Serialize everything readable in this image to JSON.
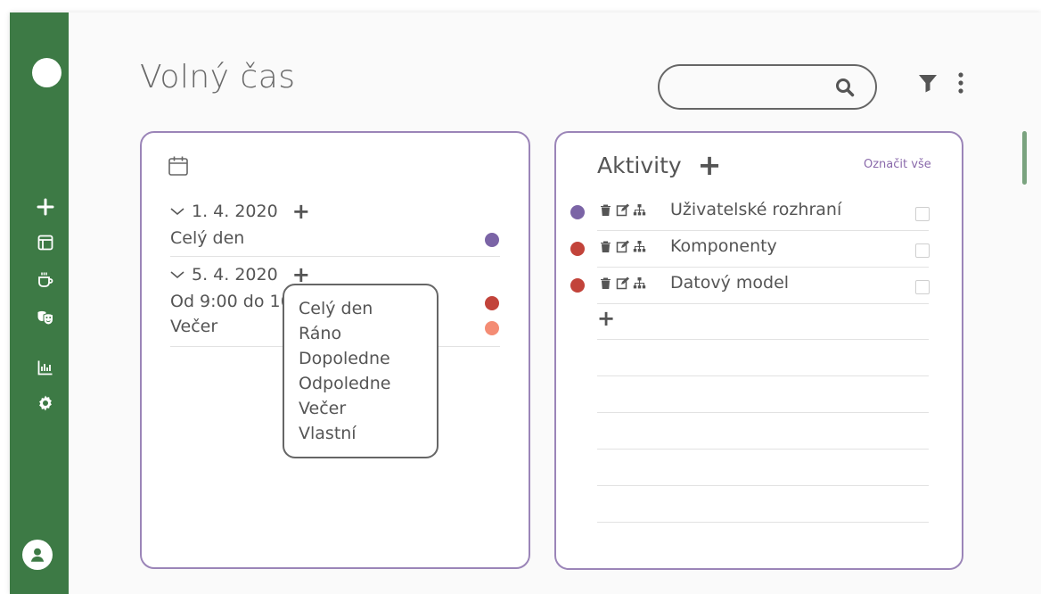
{
  "page": {
    "title": "Volný čas"
  },
  "search": {
    "value": "",
    "placeholder": ""
  },
  "toolbar": {
    "filter_icon": "filter-icon",
    "more_icon": "more-vertical-icon"
  },
  "sidebar": {
    "items": [
      {
        "icon": "plus-icon"
      },
      {
        "icon": "layout-icon"
      },
      {
        "icon": "coffee-icon"
      },
      {
        "icon": "theater-masks-icon"
      },
      {
        "icon": "bar-chart-icon"
      },
      {
        "icon": "gear-icon"
      }
    ],
    "avatar_icon": "user-icon"
  },
  "calendar": {
    "days": [
      {
        "date": "1. 4. 2020",
        "events": [
          {
            "label": "Celý den",
            "color": "#7b64a6"
          }
        ]
      },
      {
        "date": "5. 4. 2020",
        "events": [
          {
            "label": "Od 9:00 do 16:",
            "color": "#c2433a"
          },
          {
            "label": "Večer",
            "color": "#f48c74"
          }
        ]
      }
    ],
    "add_symbol": "+"
  },
  "dropdown": {
    "options": [
      "Celý den",
      "Ráno",
      "Dopoledne",
      "Odpoledne",
      "Večer",
      "Vlastní"
    ]
  },
  "activities": {
    "title": "Aktivity",
    "add_symbol": "+",
    "mark_all": "Označit vše",
    "items": [
      {
        "name": "Uživatelské rozhraní",
        "color": "#7b64a6",
        "checked": false
      },
      {
        "name": "Komponenty",
        "color": "#c2433a",
        "checked": false
      },
      {
        "name": "Datový model",
        "color": "#c2433a",
        "checked": false
      }
    ],
    "add_row_symbol": "+"
  },
  "colors": {
    "sidebar": "#3d7a45",
    "card_border": "#9b85b8",
    "accent": "#8a6aab"
  }
}
